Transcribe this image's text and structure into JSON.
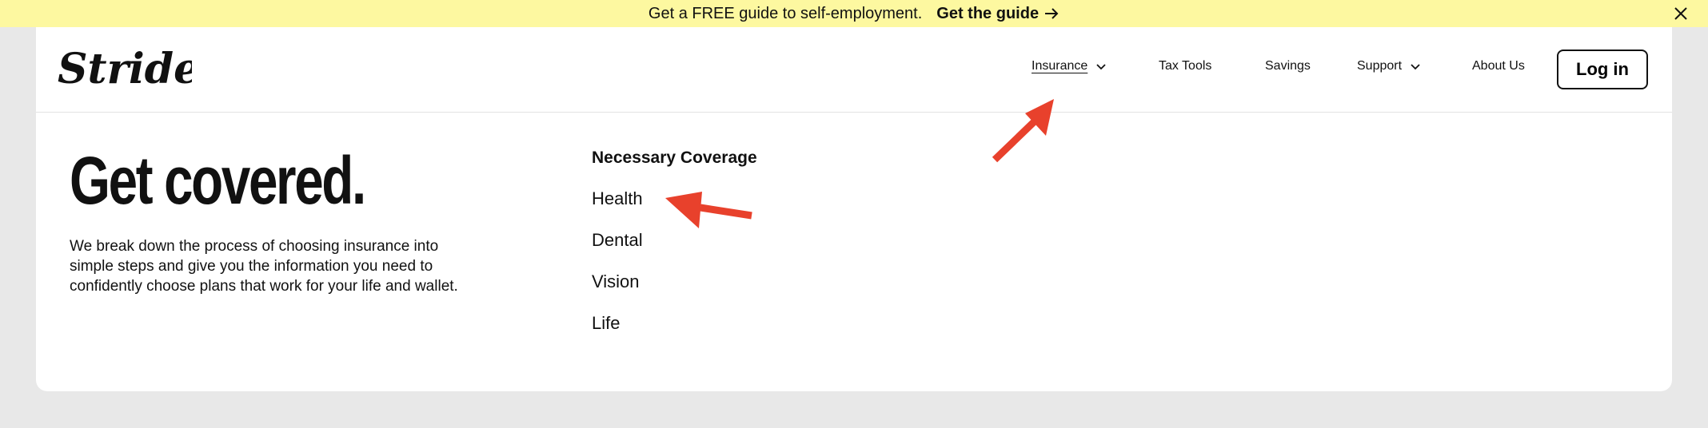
{
  "banner": {
    "message": "Get a FREE guide to self-employment.",
    "cta_label": "Get the guide",
    "cta_icon": "arrow-right-icon",
    "close_icon": "close-icon",
    "background": "#fdf8a0"
  },
  "header": {
    "logo_text": "Stride",
    "nav": [
      {
        "label": "Insurance",
        "has_dropdown": true,
        "active": true
      },
      {
        "label": "Tax Tools",
        "has_dropdown": false
      },
      {
        "label": "Savings",
        "has_dropdown": false
      },
      {
        "label": "Support",
        "has_dropdown": true
      },
      {
        "label": "About Us",
        "has_dropdown": false
      }
    ],
    "login_label": "Log in"
  },
  "mega_menu": {
    "title": "Get covered.",
    "description": "We break down the process of choosing insurance into simple steps and give you the information you need to confidently choose plans that work for your life and wallet.",
    "section_heading": "Necessary Coverage",
    "links": [
      "Health",
      "Dental",
      "Vision",
      "Life"
    ]
  },
  "annotations": {
    "arrow_color": "#e8412c"
  }
}
